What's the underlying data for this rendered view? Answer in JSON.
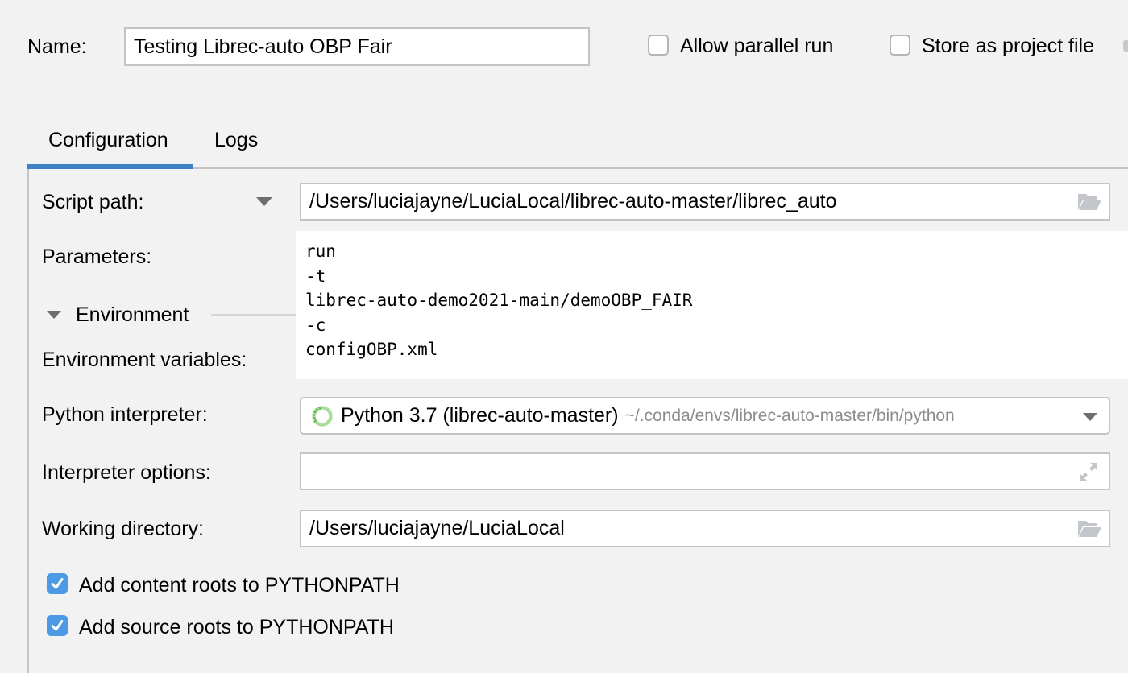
{
  "header": {
    "name_label": "Name:",
    "name_value": "Testing Librec-auto OBP Fair",
    "allow_parallel_run": {
      "label": "Allow parallel run",
      "checked": false
    },
    "store_as_project_file": {
      "label": "Store as project file",
      "checked": false
    }
  },
  "tabs": [
    {
      "label": "Configuration",
      "active": true
    },
    {
      "label": "Logs",
      "active": false
    }
  ],
  "form": {
    "script_path": {
      "label": "Script path:",
      "value": "/Users/luciajayne/LuciaLocal/librec-auto-master/librec_auto"
    },
    "parameters": {
      "label": "Parameters:",
      "lines": [
        "run",
        "-t",
        "librec-auto-demo2021-main/demoOBP_FAIR",
        "-c",
        "configOBP.xml"
      ]
    },
    "environment_section": {
      "label": "Environment",
      "expanded": true
    },
    "environment_variables": {
      "label": "Environment variables:"
    },
    "python_interpreter": {
      "label": "Python interpreter:",
      "value": "Python 3.7 (librec-auto-master)",
      "path_hint": "~/.conda/envs/librec-auto-master/bin/python"
    },
    "interpreter_options": {
      "label": "Interpreter options:",
      "value": ""
    },
    "working_directory": {
      "label": "Working directory:",
      "value": "/Users/luciajayne/LuciaLocal"
    },
    "add_content_roots": {
      "label": "Add content roots to PYTHONPATH",
      "checked": true
    },
    "add_source_roots": {
      "label": "Add source roots to PYTHONPATH",
      "checked": true
    }
  },
  "colors": {
    "accent": "#3c80c6",
    "checkbox_checked": "#4c9ae6",
    "interpreter_icon": "#5bb847",
    "icon_gray": "#c3c7cb"
  }
}
